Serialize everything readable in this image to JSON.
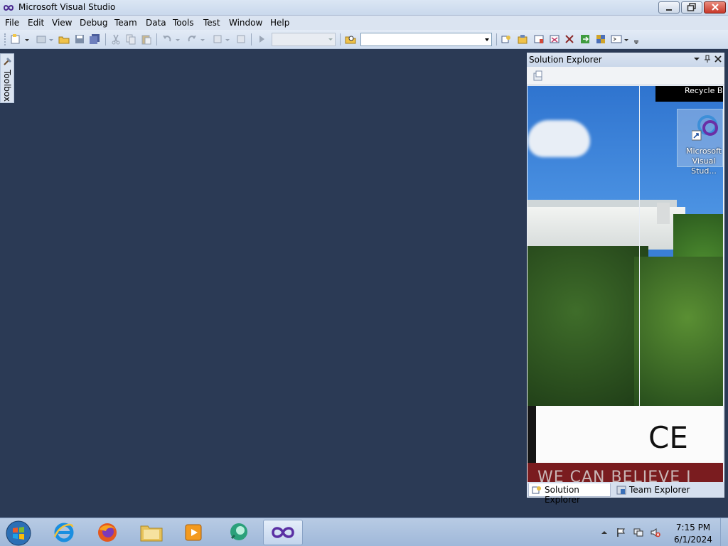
{
  "window": {
    "title": "Microsoft Visual Studio"
  },
  "menu": [
    "File",
    "Edit",
    "View",
    "Debug",
    "Team",
    "Data",
    "Tools",
    "Test",
    "Window",
    "Help"
  ],
  "toolbar": {
    "config_value": "",
    "find_value": ""
  },
  "toolbox": {
    "label": "Toolbox"
  },
  "solution_explorer": {
    "title": "Solution Explorer",
    "tabs": [
      "Solution Explorer",
      "Team Explorer"
    ]
  },
  "desktop": {
    "recycle_label": "Recycle Bi",
    "shortcut_label": "Microsoft\nVisual Stud...",
    "board_text": "CE",
    "banner_text": "WE CAN BELIEVE I"
  },
  "taskbar": {
    "apps": [
      "start-orb",
      "internet-explorer",
      "firefox",
      "file-explorer",
      "media-player",
      "messenger",
      "visual-studio"
    ],
    "active_app": "visual-studio"
  },
  "clock": {
    "time": "7:15 PM",
    "date": "6/1/2024"
  }
}
